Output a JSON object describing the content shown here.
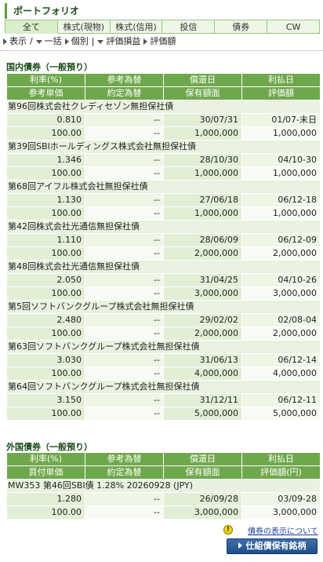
{
  "page_title": "ポートフォリオ",
  "tabs": [
    "全て",
    "株式(現物)",
    "株式(信用)",
    "投信",
    "債券",
    "CW"
  ],
  "controls": {
    "display": "表示",
    "bulk": "一括",
    "individual": "個別",
    "sep": "|",
    "slash": "/",
    "valuation_pl": "評価損益",
    "valuation_amount": "評価額"
  },
  "domestic": {
    "title": "国内債券（一般預り）",
    "headers_row1": [
      "利率(%)",
      "参考為替",
      "償還日",
      "利払日"
    ],
    "headers_row2": [
      "参考単価",
      "約定為替",
      "保有額面",
      "評価額"
    ],
    "bonds": [
      {
        "name": "第96回株式会社クレディセゾン無担保社債",
        "rate": "0.810",
        "ref_fx": "--",
        "maturity": "30/07/31",
        "coupon": "01/07-末日",
        "unit_price": "100.00",
        "trade_fx": "--",
        "face": "1,000,000",
        "value": "1,000,000"
      },
      {
        "name": "第39回SBIホールディングス株式会社無担保社債",
        "rate": "1.346",
        "ref_fx": "--",
        "maturity": "28/10/30",
        "coupon": "04/10-30",
        "unit_price": "100.00",
        "trade_fx": "--",
        "face": "1,000,000",
        "value": "1,000,000"
      },
      {
        "name": "第68回アイフル株式会社無担保社債",
        "rate": "1.130",
        "ref_fx": "--",
        "maturity": "27/06/18",
        "coupon": "06/12-18",
        "unit_price": "100.00",
        "trade_fx": "--",
        "face": "1,000,000",
        "value": "1,000,000"
      },
      {
        "name": "第42回株式会社光通信無担保社債",
        "rate": "1.110",
        "ref_fx": "--",
        "maturity": "28/06/09",
        "coupon": "06/12-09",
        "unit_price": "100.00",
        "trade_fx": "--",
        "face": "2,000,000",
        "value": "2,000,000"
      },
      {
        "name": "第48回株式会社光通信無担保社債",
        "rate": "2.050",
        "ref_fx": "--",
        "maturity": "31/04/25",
        "coupon": "04/10-26",
        "unit_price": "100.00",
        "trade_fx": "--",
        "face": "3,000,000",
        "value": "3,000,000"
      },
      {
        "name": "第5回ソフトバンクグループ株式会社無担保社債",
        "rate": "2.480",
        "ref_fx": "--",
        "maturity": "29/02/02",
        "coupon": "02/08-04",
        "unit_price": "100.00",
        "trade_fx": "--",
        "face": "2,000,000",
        "value": "2,000,000"
      },
      {
        "name": "第63回ソフトバンクグループ株式会社無担保社債",
        "rate": "3.030",
        "ref_fx": "--",
        "maturity": "31/06/13",
        "coupon": "06/12-14",
        "unit_price": "100.00",
        "trade_fx": "--",
        "face": "4,000,000",
        "value": "4,000,000"
      },
      {
        "name": "第64回ソフトバンクグループ株式会社無担保社債",
        "rate": "3.150",
        "ref_fx": "--",
        "maturity": "31/12/11",
        "coupon": "06/12-11",
        "unit_price": "100.00",
        "trade_fx": "--",
        "face": "5,000,000",
        "value": "5,000,000"
      }
    ]
  },
  "foreign": {
    "title": "外国債券（一般預り）",
    "headers_row1": [
      "利率(%)",
      "参考為替",
      "償還日",
      "利払日"
    ],
    "headers_row2": [
      "買付単価",
      "約定為替",
      "保有額面",
      "評価額(円)"
    ],
    "bonds": [
      {
        "name": "MW353 第46回SBI債 1.28% 20260928 (JPY)",
        "rate": "1.280",
        "ref_fx": "--",
        "maturity": "26/09/28",
        "coupon": "03/09-28",
        "unit_price": "100.00",
        "trade_fx": "--",
        "face": "3,000,000",
        "value": "3,000,000"
      }
    ]
  },
  "footer": {
    "help_link": "債券の表示について",
    "holdings_button": "仕組債保有銘柄"
  },
  "colors": {
    "header_green": "#6fa84c",
    "row_light": "#e2efd6",
    "button_blue": "#1e4f8a"
  }
}
